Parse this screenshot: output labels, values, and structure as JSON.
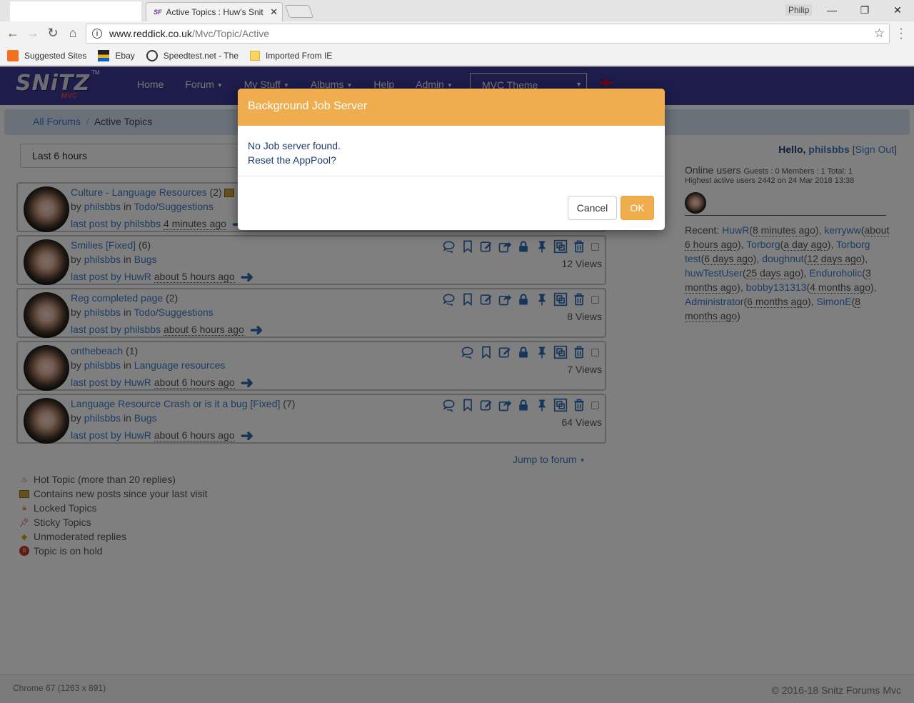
{
  "browser": {
    "tab_title": "Active Topics : Huw's Snit",
    "tab_favicon": "SF",
    "window_user": "Philip",
    "url_host": "www.reddick.co.uk",
    "url_path": "/Mvc/Topic/Active",
    "bookmarks": [
      {
        "label": "Suggested Sites",
        "icon": "suggested-sites-icon"
      },
      {
        "label": "Ebay",
        "icon": "ebay-icon"
      },
      {
        "label": "Speedtest.net - The",
        "icon": "speedtest-icon"
      },
      {
        "label": "Imported From IE",
        "icon": "folder-icon"
      }
    ]
  },
  "navbar": {
    "logo_text": "SNiTZ",
    "logo_sub": "MVC",
    "logo_tm": "TM",
    "items": [
      "Home",
      "Forum",
      "My Stuff",
      "Albums",
      "Help",
      "Admin"
    ],
    "theme_select": "MVC Theme"
  },
  "breadcrumb": {
    "root": "All Forums",
    "separator": "/",
    "current": "Active Topics"
  },
  "filter": {
    "selected": "Last 6 hours"
  },
  "topics": [
    {
      "title": "Culture - Language Resources",
      "count": "(2)",
      "by": "by",
      "author": "philsbbs",
      "in": "in",
      "forum": "Todo/Suggestions",
      "last_post": "last post by",
      "last_user": "philsbbs",
      "time": "4 minutes ago",
      "views": ""
    },
    {
      "title": "Smilies [Fixed]",
      "count": "(6)",
      "by": "by",
      "author": "philsbbs",
      "in": "in",
      "forum": "Bugs",
      "last_post": "last post by",
      "last_user": "HuwR",
      "time": "about 5 hours ago",
      "views": "12 Views"
    },
    {
      "title": "Reg completed page",
      "count": "(2)",
      "by": "by",
      "author": "philsbbs",
      "in": "in",
      "forum": "Todo/Suggestions",
      "last_post": "last post by",
      "last_user": "philsbbs",
      "time": "about 6 hours ago",
      "views": "8 Views"
    },
    {
      "title": "onthebeach",
      "count": "(1)",
      "by": "by",
      "author": "philsbbs",
      "in": "in",
      "forum": "Language resources",
      "last_post": "last post by",
      "last_user": "HuwR",
      "time": "about 6 hours ago",
      "views": "7 Views"
    },
    {
      "title": "Language Resource Crash or is it a bug [Fixed]",
      "count": "(7)",
      "by": "by",
      "author": "philsbbs",
      "in": "in",
      "forum": "Bugs",
      "last_post": "last post by",
      "last_user": "HuwR",
      "time": "about 6 hours ago",
      "views": "64 Views"
    }
  ],
  "jump_to_forum": "Jump to forum",
  "legend": [
    {
      "label": "Hot Topic (more than 20 replies)",
      "icon": "hot-topic-icon"
    },
    {
      "label": "Contains new posts since your last visit",
      "icon": "new-posts-icon"
    },
    {
      "label": "Locked Topics",
      "icon": "locked-icon"
    },
    {
      "label": "Sticky Topics",
      "icon": "sticky-pin-icon"
    },
    {
      "label": "Unmoderated replies",
      "icon": "unmoderated-icon"
    },
    {
      "label": "Topic is on hold",
      "icon": "on-hold-icon"
    }
  ],
  "sidebar": {
    "hello": "Hello,",
    "user": "philsbbs",
    "signout": "Sign Out",
    "online_title": "Online users",
    "online_counts": "Guests : 0 Members : 1 Total: 1",
    "highest": "Highest active users 2442 on 24 Mar 2018 13:38",
    "recent_label": "Recent:",
    "recent_users": [
      {
        "name": "HuwR",
        "time": "8 minutes ago"
      },
      {
        "name": "kerryww",
        "time": "about 6 hours ago"
      },
      {
        "name": "Torborg",
        "time": "a day ago"
      },
      {
        "name": "Torborg test",
        "time": "6 days ago"
      },
      {
        "name": "doughnut",
        "time": "12 days ago"
      },
      {
        "name": "huwTestUser",
        "time": "25 days ago"
      },
      {
        "name": "Enduroholic",
        "time": "3 months ago"
      },
      {
        "name": "bobby131313",
        "time": "4 months ago"
      },
      {
        "name": "Administrator",
        "time": "6 months ago"
      },
      {
        "name": "SimonE",
        "time": "8 months ago"
      }
    ]
  },
  "footer": {
    "left": "Chrome 67 (1263 x 891)",
    "right": "© 2016-18 Snitz Forums Mvc"
  },
  "modal": {
    "title": "Background Job Server",
    "line1": "No Job server found.",
    "line2": "Reset the AppPool?",
    "cancel": "Cancel",
    "ok": "OK"
  },
  "colors": {
    "navbar": "#3b3996",
    "modal_header": "#f0ad4e",
    "link": "#3a7bc8"
  }
}
